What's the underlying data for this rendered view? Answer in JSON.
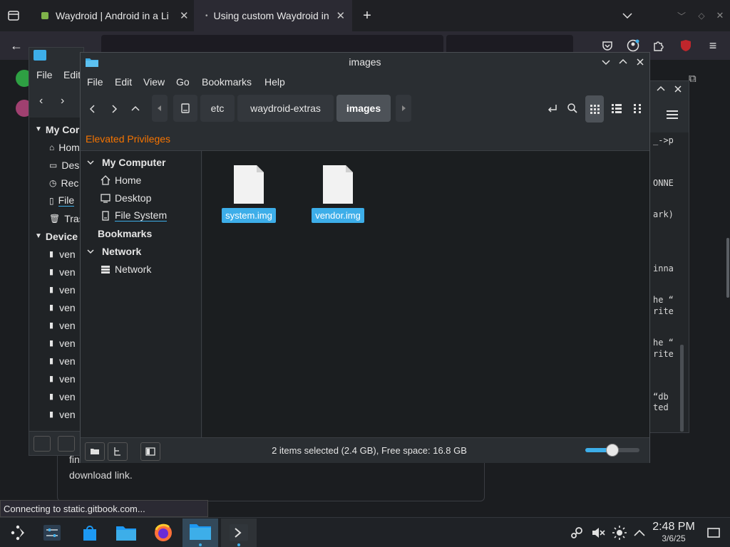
{
  "browser": {
    "tabs": [
      {
        "label": "Waydroid | Android in a Li",
        "close": "✕"
      },
      {
        "label": "Using custom Waydroid in",
        "close": "✕",
        "active": true
      }
    ],
    "new_tab": "+",
    "web_status": "Connecting to static.gitbook.com..."
  },
  "page_fragments": {
    "line1": "fin",
    "line2": "download link."
  },
  "back_window": {
    "menu": [
      "File",
      "Edit"
    ],
    "section_my_computer": "My Cor",
    "places": [
      "Hom",
      "Des",
      "Rec",
      "File",
      "Tras"
    ],
    "section_devices": "Device",
    "devices": [
      "ven",
      "ven",
      "ven",
      "ven",
      "ven",
      "ven",
      "ven",
      "ven",
      "ven",
      "ven"
    ]
  },
  "terminal": {
    "lines": [
      "_->p",
      "ONNE",
      "ark)",
      "inna",
      "he “",
      "rite",
      "he “",
      "rite",
      "“db",
      "ted"
    ]
  },
  "dolphin": {
    "title": "images",
    "menu": [
      "File",
      "Edit",
      "View",
      "Go",
      "Bookmarks",
      "Help"
    ],
    "breadcrumbs": [
      "etc",
      "waydroid-extras",
      "images"
    ],
    "elevated": "Elevated Privileges",
    "sidebar": {
      "my_computer": "My Computer",
      "places": [
        "Home",
        "Desktop",
        "File System"
      ],
      "bookmarks": "Bookmarks",
      "network_head": "Network",
      "network_items": [
        "Network"
      ]
    },
    "files": [
      "system.img",
      "vendor.img"
    ],
    "status": "2 items selected (2.4 GB), Free space: 16.8 GB",
    "zoom_level": 0.5
  },
  "taskbar": {
    "time": "2:48 PM",
    "date": "3/6/25"
  },
  "colors": {
    "accent": "#3daee9",
    "elevated": "#f67400"
  }
}
